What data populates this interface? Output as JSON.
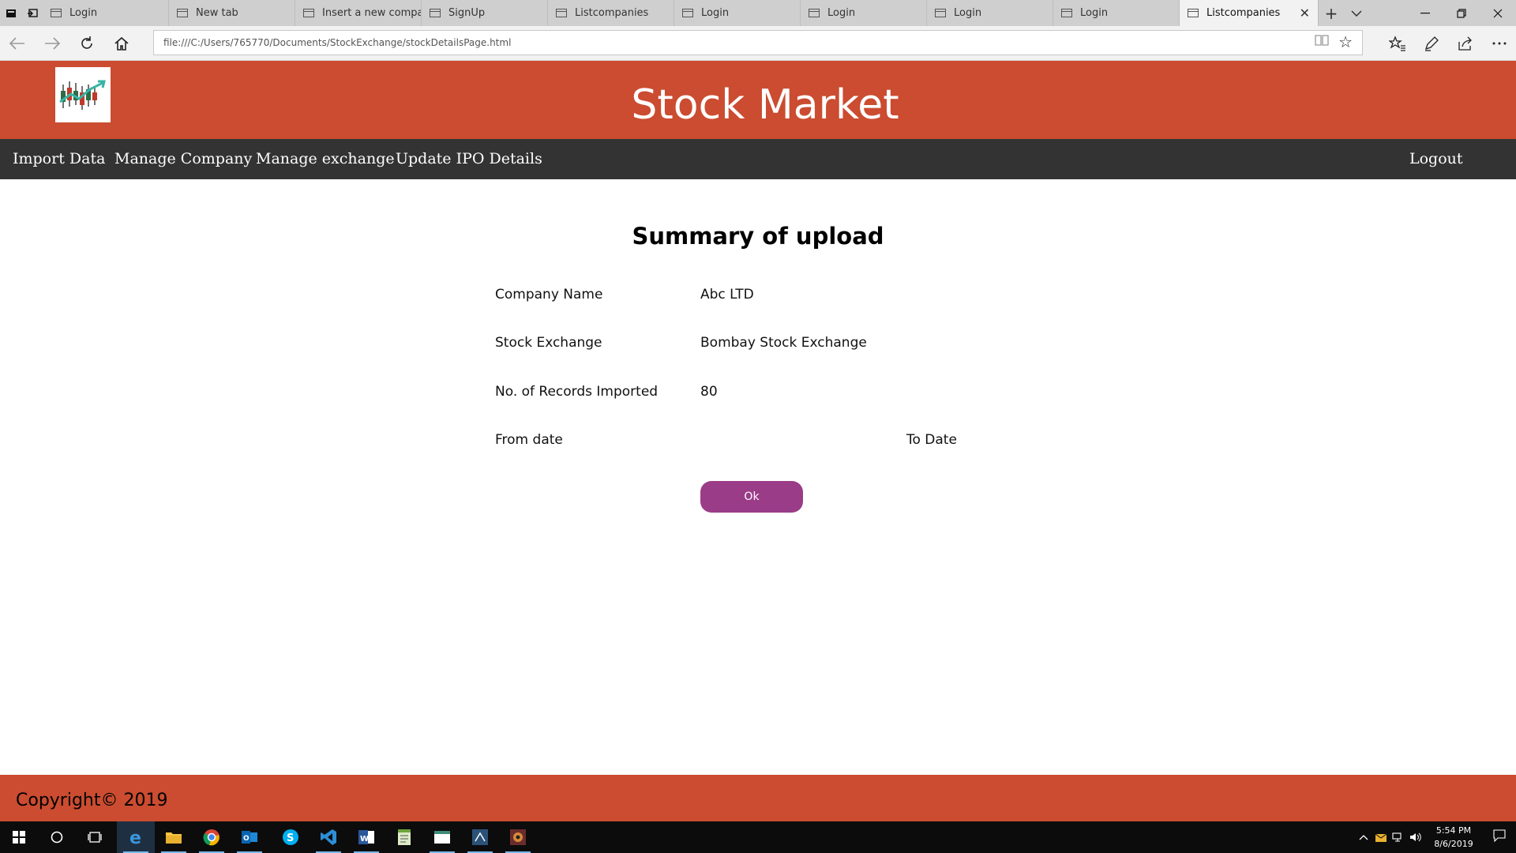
{
  "browser": {
    "tabs": [
      {
        "label": "Login",
        "icon": "page-icon"
      },
      {
        "label": "New tab",
        "icon": "newtab-icon"
      },
      {
        "label": "Insert a new compan",
        "icon": "page-icon"
      },
      {
        "label": "SignUp",
        "icon": "page-icon"
      },
      {
        "label": "Listcompanies",
        "icon": "page-icon"
      },
      {
        "label": "Login",
        "icon": "page-icon"
      },
      {
        "label": "Login",
        "icon": "page-icon"
      },
      {
        "label": "Login",
        "icon": "page-icon"
      },
      {
        "label": "Login",
        "icon": "page-icon"
      }
    ],
    "active_tab": {
      "label": "Listcompanies",
      "close": "✕"
    },
    "url": "file:///C:/Users/765770/Documents/StockExchange/stockDetailsPage.html"
  },
  "header": {
    "title": "Stock Market",
    "background": "#cb4c30"
  },
  "menu": {
    "items": [
      "Import Data",
      "Manage Company",
      "Manage exchange",
      "Update IPO Details"
    ],
    "logout": "Logout",
    "background": "#333333"
  },
  "summary": {
    "title": "Summary of upload",
    "company_name_label": "Company Name",
    "company_name_value": "Abc LTD",
    "exchange_label": "Stock Exchange",
    "exchange_value": "Bombay Stock Exchange",
    "records_label": "No. of Records Imported",
    "records_value": "80",
    "from_date_label": "From date",
    "to_date_label": "To Date",
    "ok_label": "Ok",
    "ok_color": "#9b3c88"
  },
  "footer": {
    "text": "Copyright© 2019"
  },
  "taskbar": {
    "time": "5:54 PM",
    "date": "8/6/2019",
    "apps": [
      "start-icon",
      "cortana-icon",
      "task-view-icon",
      "edge-icon",
      "file-explorer-icon",
      "chrome-icon",
      "outlook-icon",
      "skype-icon",
      "vscode-icon",
      "word-icon",
      "notepad-icon",
      "app-icon",
      "sql-icon",
      "game-icon"
    ]
  }
}
